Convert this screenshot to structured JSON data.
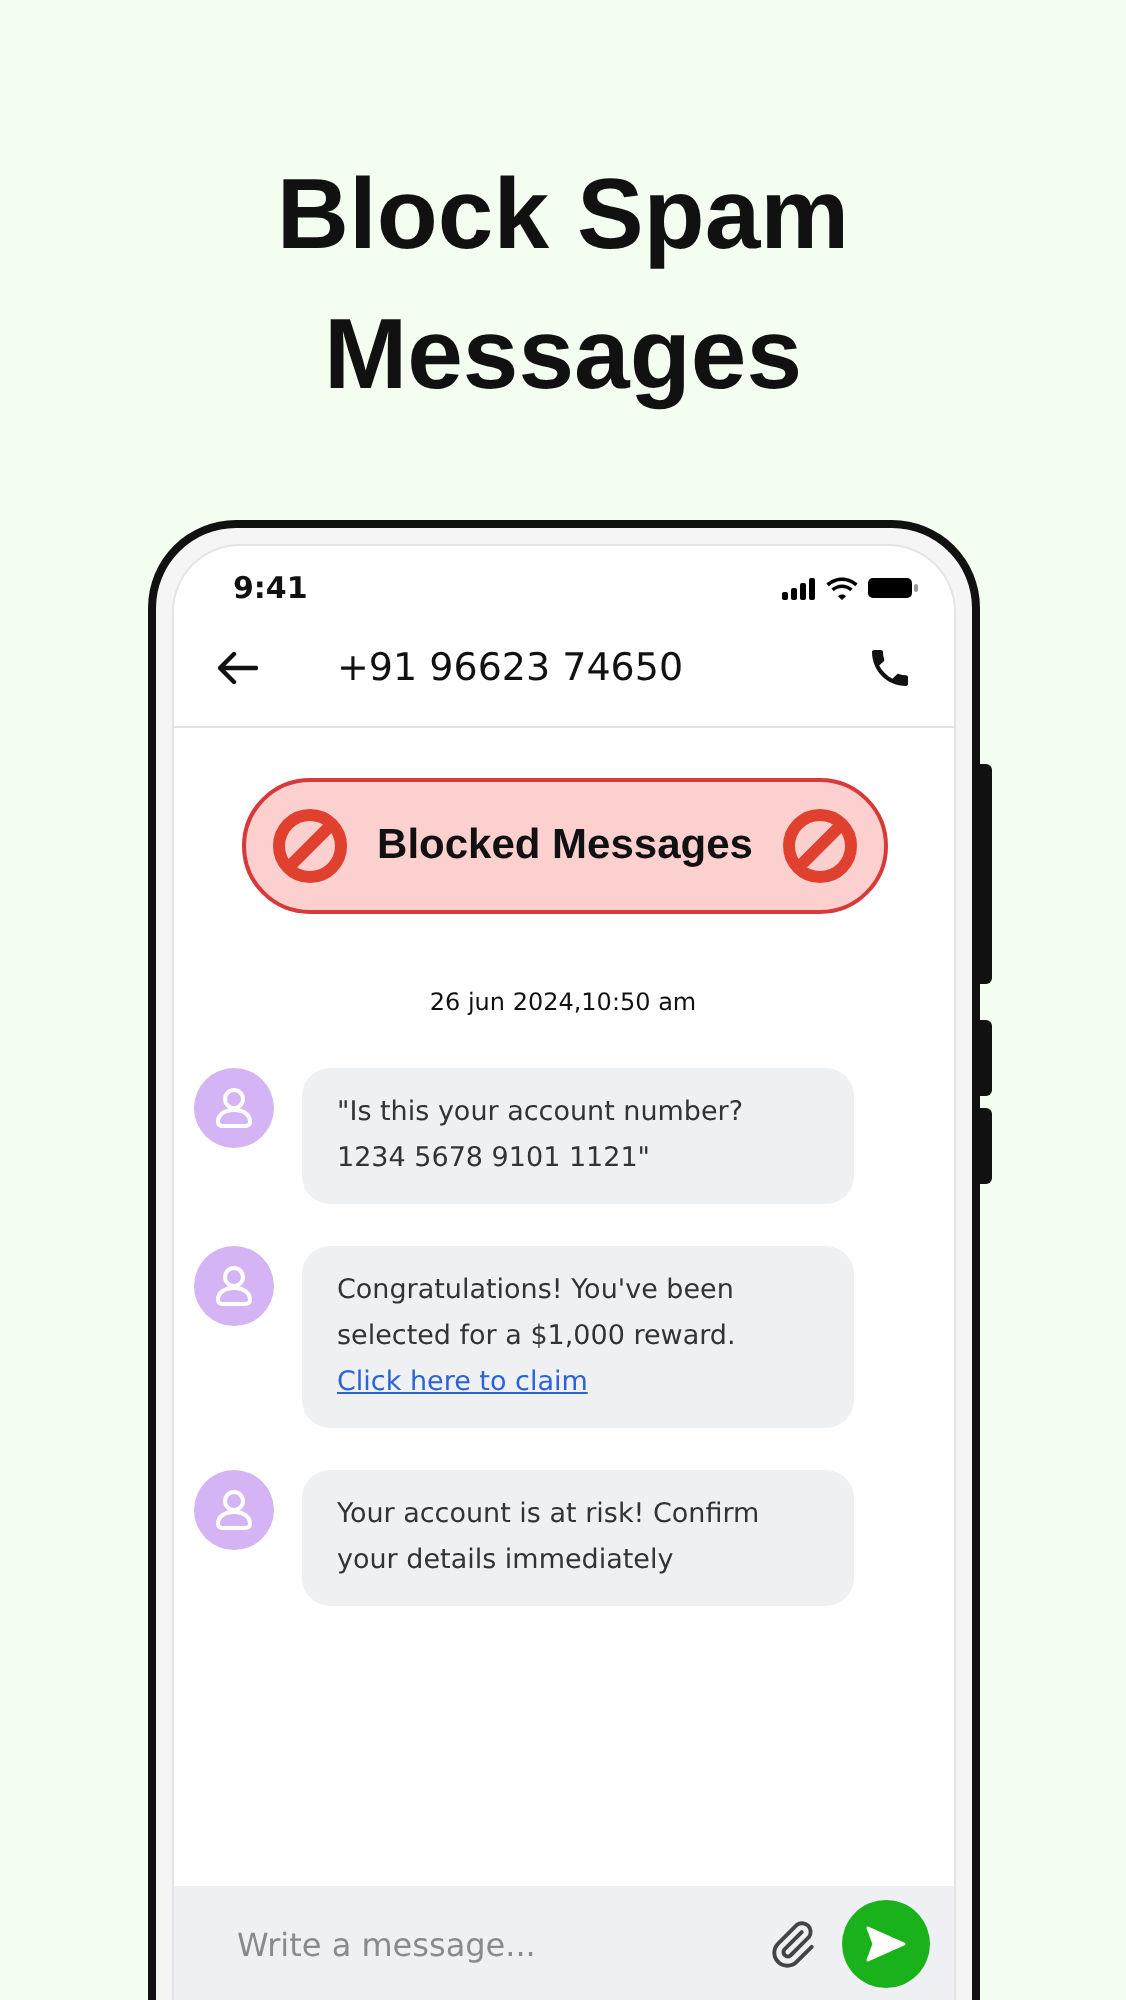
{
  "headline": [
    "Block Spam",
    "Messages"
  ],
  "status_bar": {
    "time": "9:41"
  },
  "header": {
    "title": "+91 96623 74650"
  },
  "banner": {
    "label": "Blocked Messages"
  },
  "date": "26 jun 2024,10:50 am",
  "messages": [
    {
      "text": "\"Is this your account number? 1234 5678 9101 1121\""
    },
    {
      "text": "Congratulations! You've been selected for a $1,000 reward.",
      "link": "Click here to claim"
    },
    {
      "text": "Your account is at risk! Confirm your details immediately"
    }
  ],
  "composer": {
    "placeholder": "Write a message..."
  }
}
